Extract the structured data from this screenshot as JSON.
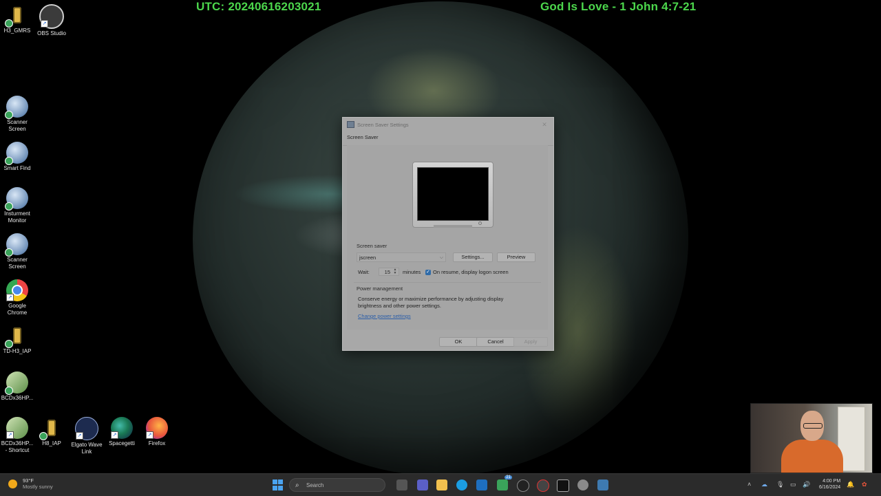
{
  "wallpaper": {
    "utc_text": "UTC: 20240616203021",
    "verse_text": "God Is Love - 1 John 4:7-21",
    "overlay_color": "#4cd64c"
  },
  "desktop_icons": [
    {
      "label": "H3_GMRS",
      "icon": "radio-icon"
    },
    {
      "label": "OBS Studio",
      "icon": "obs-icon"
    },
    {
      "label": "Scanner Screen",
      "icon": "paw-icon"
    },
    {
      "label": "Smart Find",
      "icon": "paw-icon"
    },
    {
      "label": "Insturment Monitor",
      "icon": "paw-icon"
    },
    {
      "label": "Scanner Screen",
      "icon": "paw-icon"
    },
    {
      "label": "Google Chrome",
      "icon": "chrome-icon"
    },
    {
      "label": "TD-H3_IAP",
      "icon": "radio-icon"
    },
    {
      "label": "BCDx36HP...",
      "icon": "shield-icon"
    },
    {
      "label": "BCDx36HP... - Shortcut",
      "icon": "shield-icon"
    },
    {
      "label": "H8_IAP",
      "icon": "radio-icon"
    },
    {
      "label": "Elgato Wave Link",
      "icon": "elgato-icon"
    },
    {
      "label": "Spacegetti",
      "icon": "spacegetti-icon"
    },
    {
      "label": "Firefox",
      "icon": "firefox-icon"
    }
  ],
  "dialog": {
    "title": "Screen Saver Settings",
    "close_glyph": "✕",
    "tab": "Screen Saver",
    "screensaver_group": "Screen saver",
    "screensaver_value": "jscreen",
    "settings_button": "Settings...",
    "preview_button": "Preview",
    "wait_label": "Wait:",
    "wait_value": "15",
    "minutes_label": "minutes",
    "resume_checkbox_label": "On resume, display logon screen",
    "resume_checked": true,
    "power_group": "Power management",
    "power_description": "Conserve energy or maximize performance by adjusting display brightness and other power settings.",
    "power_link": "Change power settings",
    "ok_button": "OK",
    "cancel_button": "Cancel",
    "apply_button": "Apply"
  },
  "taskbar": {
    "weather_temp": "93°F",
    "weather_desc": "Mostly sunny",
    "search_placeholder": "Search",
    "time": "4:00 PM",
    "date": "6/16/2024",
    "notification_badge": "21"
  }
}
